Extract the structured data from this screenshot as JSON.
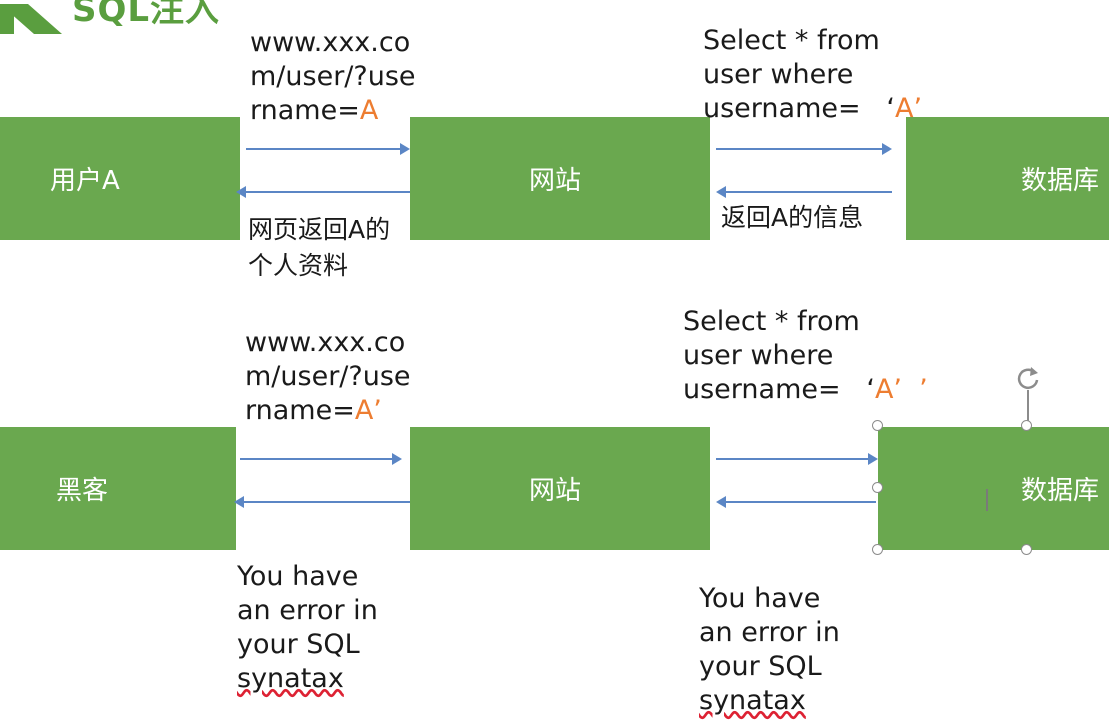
{
  "slide": {
    "title": "SQL注入",
    "row1": {
      "user_box": "用户A",
      "site_box": "网站",
      "db_box": "数据库",
      "request_text": "www.xxx.co\nm/user/?use\nrname=",
      "request_value": "A",
      "query_text": "Select * from\nuser where\nusername=   ‘",
      "query_value": "A",
      "query_close": "’",
      "response_site_to_user": "网页返回A的\n个人资料",
      "response_db_to_site": "返回A的信息"
    },
    "row2": {
      "hacker_box": "黑客",
      "site_box": "网站",
      "db_box": "数据库",
      "request_text": "www.xxx.co\nm/user/?use\nrname=",
      "request_value": "A’",
      "query_text": "Select * from\nuser where\nusername=   ‘",
      "query_value": "A’",
      "query_close": "  ’",
      "error_left": "You have\nan error in\nyour SQL\n",
      "error_left_word": "synatax",
      "error_right": "You have\nan error in\nyour SQL\n",
      "error_right_word": "synatax"
    }
  },
  "colors": {
    "box_green": "#6aa84f",
    "title_green": "#5a9e3f",
    "arrow_blue": "#5b86c5",
    "highlight_orange": "#ed7d31"
  },
  "icons": {
    "rotate_handle": "rotate-icon",
    "text_cursor": "text-cursor-icon"
  }
}
